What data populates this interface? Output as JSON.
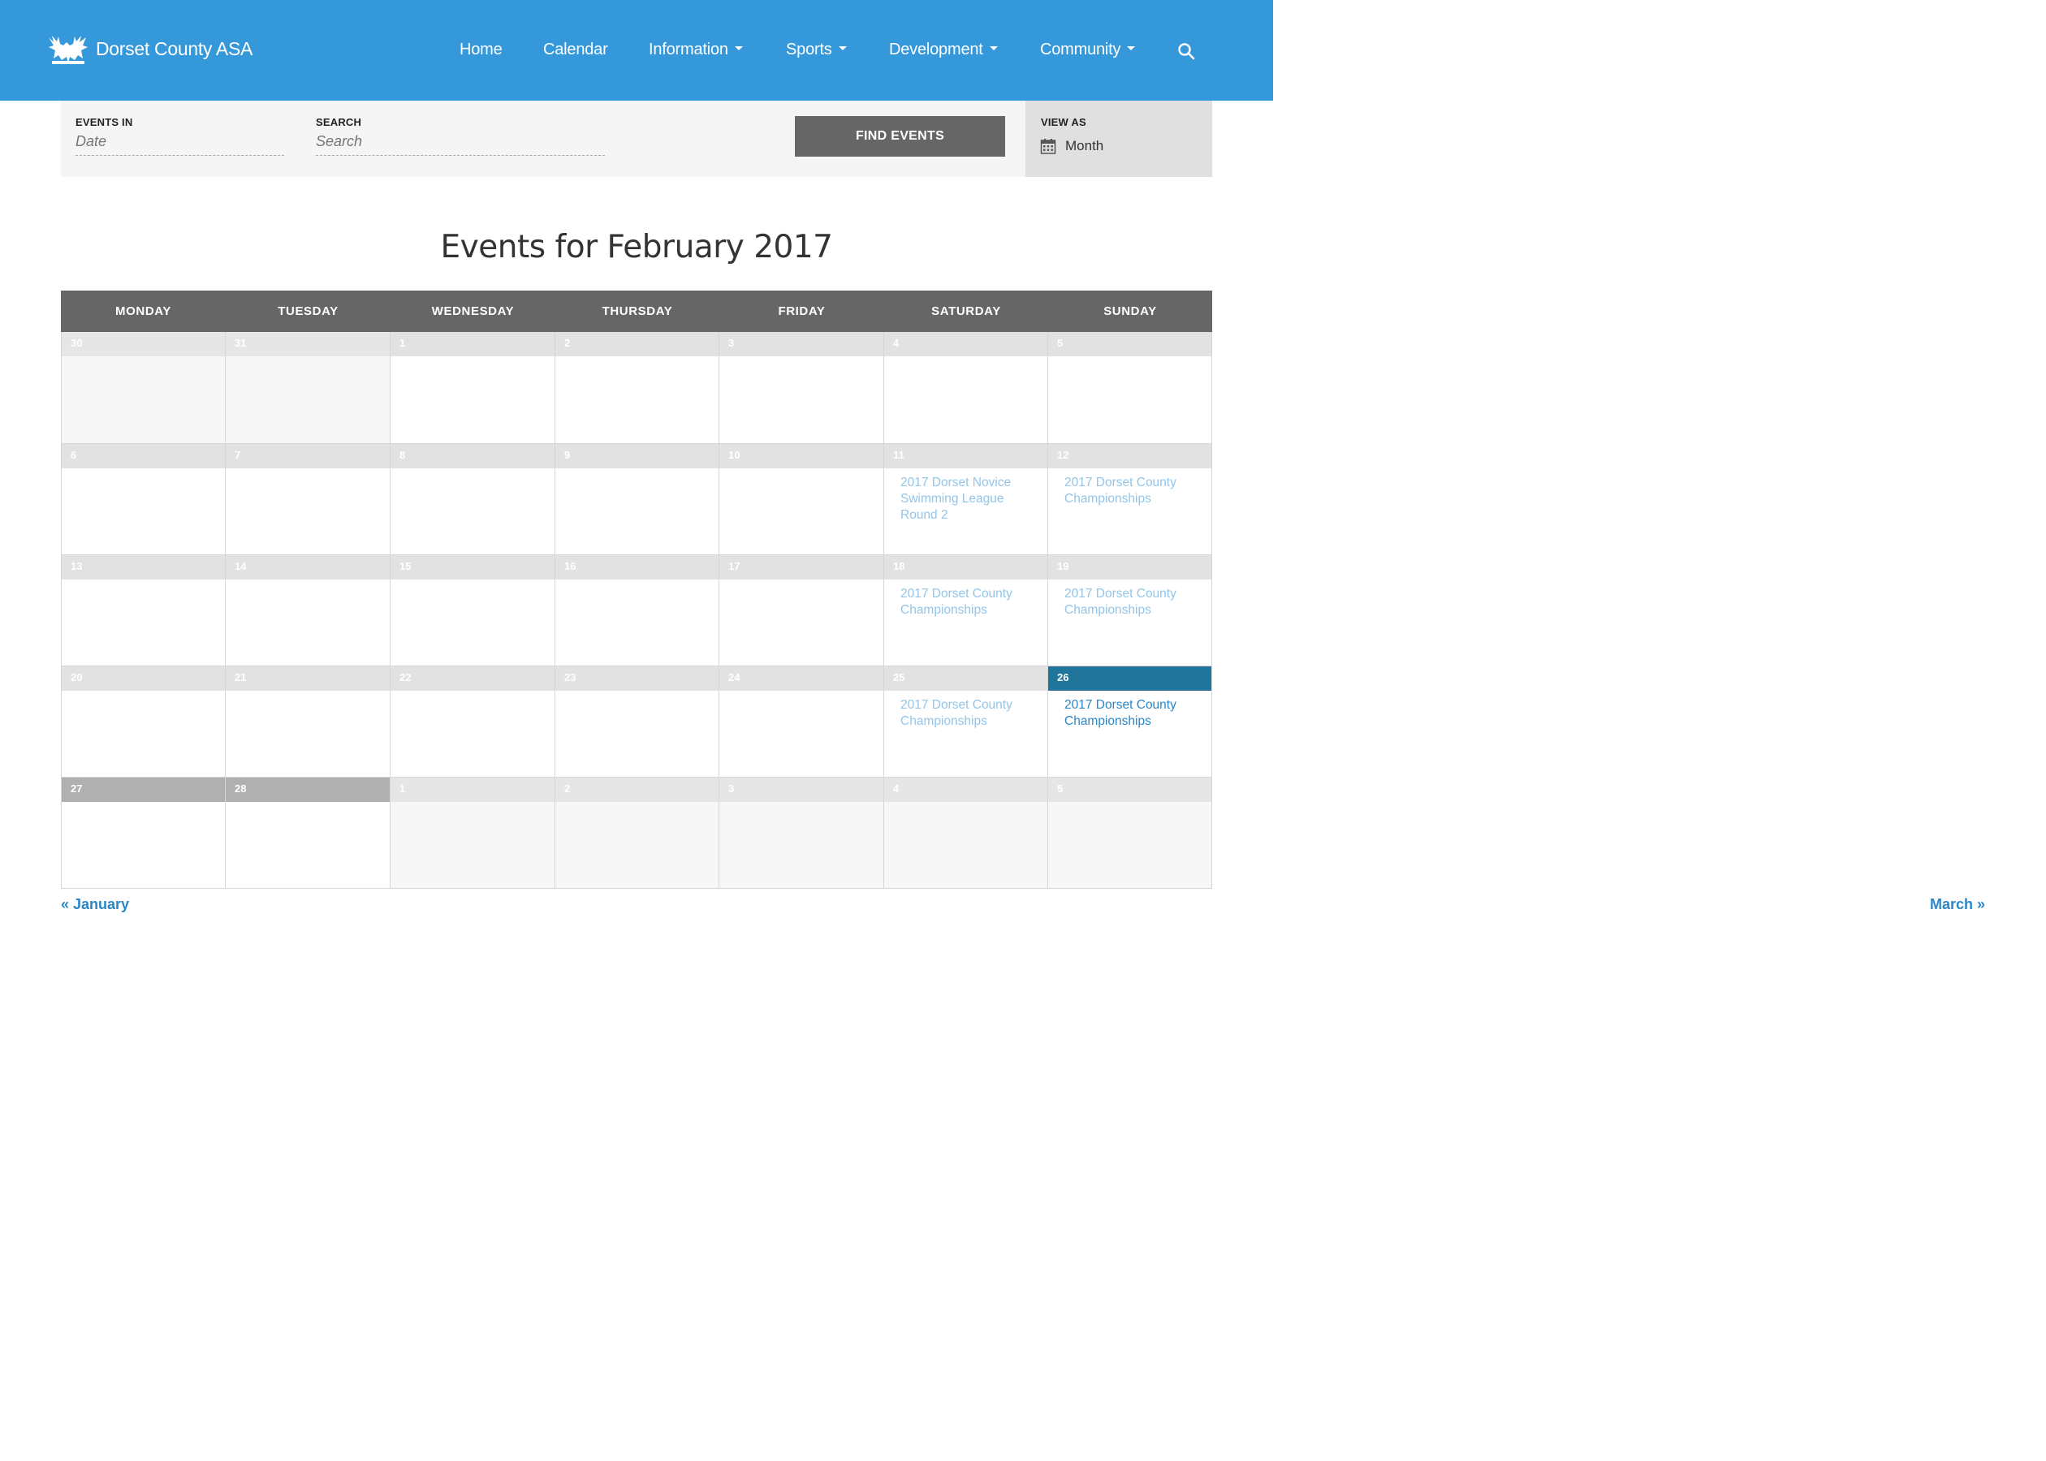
{
  "site": {
    "title": "Dorset County ASA"
  },
  "nav": {
    "items": [
      {
        "label": "Home",
        "dropdown": false
      },
      {
        "label": "Calendar",
        "dropdown": false
      },
      {
        "label": "Information",
        "dropdown": true
      },
      {
        "label": "Sports",
        "dropdown": true
      },
      {
        "label": "Development",
        "dropdown": true
      },
      {
        "label": "Community",
        "dropdown": true
      }
    ],
    "search_icon": "search-icon"
  },
  "filters": {
    "events_in_label": "EVENTS IN",
    "date_placeholder": "Date",
    "search_label": "SEARCH",
    "search_placeholder": "Search",
    "find_button": "FIND EVENTS",
    "view_as_label": "VIEW AS",
    "view_as_value": "Month"
  },
  "page_title": "Events for February 2017",
  "calendar": {
    "weekdays": [
      "MONDAY",
      "TUESDAY",
      "WEDNESDAY",
      "THURSDAY",
      "FRIDAY",
      "SATURDAY",
      "SUNDAY"
    ],
    "weeks": [
      [
        {
          "day": "30",
          "state": "other",
          "events": []
        },
        {
          "day": "31",
          "state": "other",
          "events": []
        },
        {
          "day": "1",
          "state": "past",
          "events": []
        },
        {
          "day": "2",
          "state": "past",
          "events": []
        },
        {
          "day": "3",
          "state": "past",
          "events": []
        },
        {
          "day": "4",
          "state": "past",
          "events": []
        },
        {
          "day": "5",
          "state": "past",
          "events": []
        }
      ],
      [
        {
          "day": "6",
          "state": "past",
          "events": []
        },
        {
          "day": "7",
          "state": "past",
          "events": []
        },
        {
          "day": "8",
          "state": "past",
          "events": []
        },
        {
          "day": "9",
          "state": "past",
          "events": []
        },
        {
          "day": "10",
          "state": "past",
          "events": []
        },
        {
          "day": "11",
          "state": "past",
          "events": [
            "2017 Dorset Novice Swimming League Round 2"
          ]
        },
        {
          "day": "12",
          "state": "past",
          "events": [
            "2017 Dorset County Championships"
          ]
        }
      ],
      [
        {
          "day": "13",
          "state": "past",
          "events": []
        },
        {
          "day": "14",
          "state": "past",
          "events": []
        },
        {
          "day": "15",
          "state": "past",
          "events": []
        },
        {
          "day": "16",
          "state": "past",
          "events": []
        },
        {
          "day": "17",
          "state": "past",
          "events": []
        },
        {
          "day": "18",
          "state": "past",
          "events": [
            "2017 Dorset County Championships"
          ]
        },
        {
          "day": "19",
          "state": "past",
          "events": [
            "2017 Dorset County Championships"
          ]
        }
      ],
      [
        {
          "day": "20",
          "state": "past",
          "events": []
        },
        {
          "day": "21",
          "state": "past",
          "events": []
        },
        {
          "day": "22",
          "state": "past",
          "events": []
        },
        {
          "day": "23",
          "state": "past",
          "events": []
        },
        {
          "day": "24",
          "state": "past",
          "events": []
        },
        {
          "day": "25",
          "state": "past",
          "events": [
            "2017 Dorset County Championships"
          ]
        },
        {
          "day": "26",
          "state": "today",
          "events": [
            "2017 Dorset County Championships"
          ]
        }
      ],
      [
        {
          "day": "27",
          "state": "highlight",
          "events": []
        },
        {
          "day": "28",
          "state": "highlight",
          "events": []
        },
        {
          "day": "1",
          "state": "other",
          "events": []
        },
        {
          "day": "2",
          "state": "other",
          "events": []
        },
        {
          "day": "3",
          "state": "other",
          "events": []
        },
        {
          "day": "4",
          "state": "other",
          "events": []
        },
        {
          "day": "5",
          "state": "other",
          "events": []
        }
      ]
    ]
  },
  "month_nav": {
    "prev": "« January",
    "next": "March »"
  },
  "colors": {
    "header_blue": "#3598db",
    "event_link_light": "#93c5e8",
    "event_link_today": "#2b86c5",
    "today_header": "#21759b",
    "weekday_bar": "#666666"
  }
}
